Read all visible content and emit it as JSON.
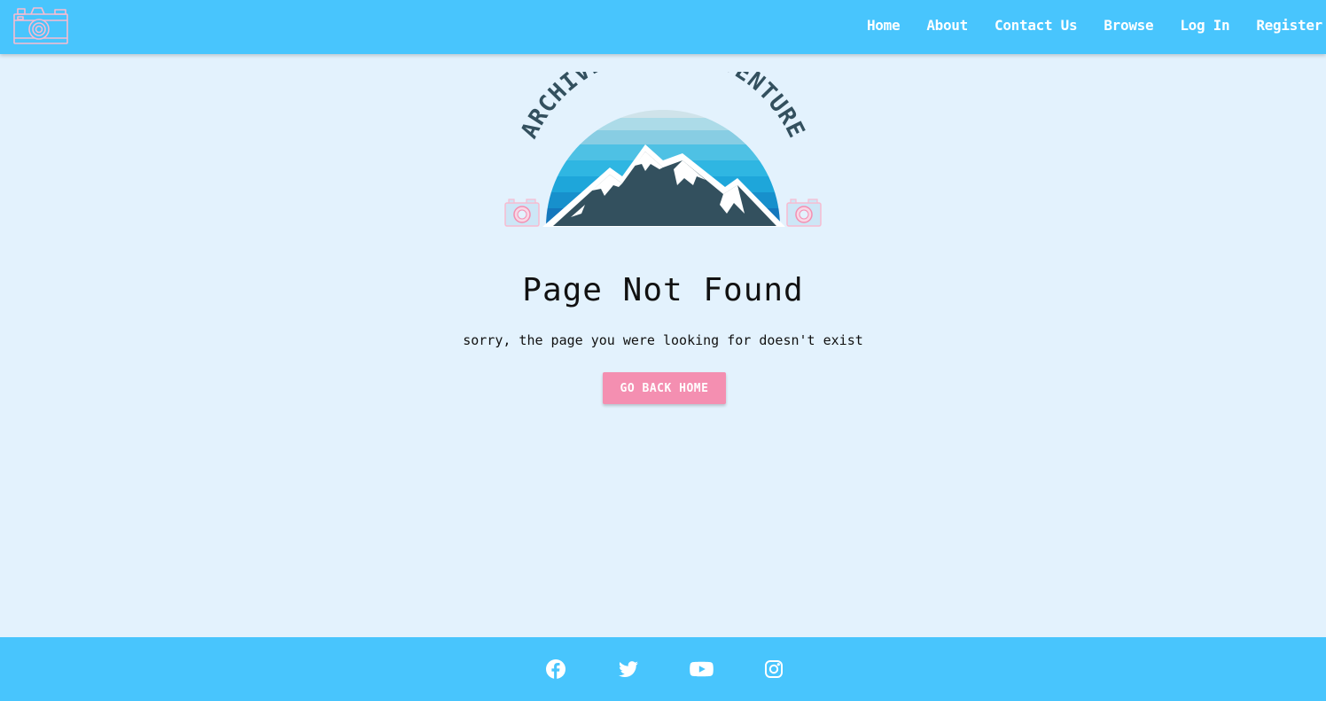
{
  "header": {
    "logo_icon": "camera-icon",
    "nav": [
      {
        "label": "Home"
      },
      {
        "label": "About"
      },
      {
        "label": "Contact Us"
      },
      {
        "label": "Browse"
      },
      {
        "label": "Log In"
      },
      {
        "label": "Register"
      }
    ]
  },
  "hero": {
    "logo_text": "ARCHIVE YOUR ADVENTURE",
    "logo_icon": "mountain-sunset-logo"
  },
  "main": {
    "title": "Page Not Found",
    "message": "sorry, the page you were looking for doesn't exist",
    "button_label": "GO BACK HOME"
  },
  "footer": {
    "social": [
      {
        "icon": "facebook-icon"
      },
      {
        "icon": "twitter-icon"
      },
      {
        "icon": "youtube-icon"
      },
      {
        "icon": "instagram-icon"
      }
    ]
  },
  "colors": {
    "header_bg": "#48c5fd",
    "page_bg": "#e3f2fd",
    "button_bg": "#f48fb1",
    "logo_dark": "#33505e",
    "nav_text": "#ffffff"
  }
}
